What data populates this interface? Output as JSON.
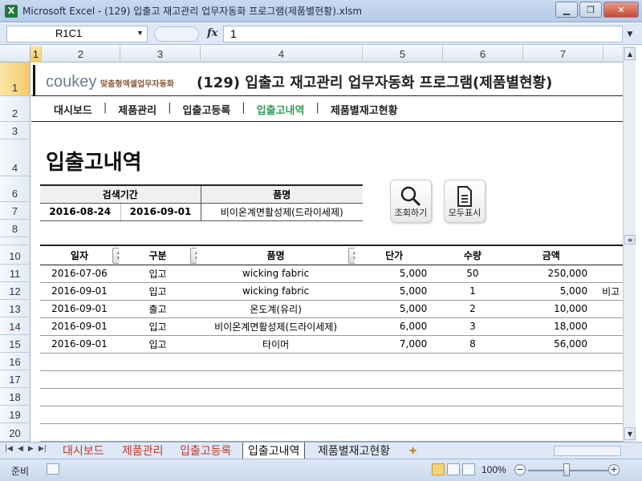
{
  "window": {
    "title": "Microsoft Excel - (129) 입출고 재고관리 업무자동화 프로그램(제품별현황).xlsm"
  },
  "formula_bar": {
    "name_box": "R1C1",
    "fx": "fx",
    "value": "1"
  },
  "columns": [
    "1",
    "2",
    "3",
    "4",
    "5",
    "6",
    "7"
  ],
  "rows": [
    "1",
    "2",
    "3",
    "4",
    "6",
    "7",
    "8",
    "9",
    "10",
    "11",
    "12",
    "13",
    "14",
    "15",
    "16",
    "17",
    "18",
    "19",
    "20"
  ],
  "brand": {
    "logo_text": "coukey",
    "logo_sub": "맞춤형엑셀업무자동화",
    "doc_title": "(129) 입출고 재고관리 업무자동화 프로그램(제품별현황)"
  },
  "nav": {
    "items": [
      "대시보드",
      "제품관리",
      "입출고등록",
      "입출고내역",
      "제품별재고현황"
    ],
    "active_index": 3,
    "active_color": "#2e9e5a"
  },
  "page_heading": "입출고내역",
  "search": {
    "period_label": "검색기간",
    "product_label": "품명",
    "date_from": "2016-08-24",
    "date_to": "2016-09-01",
    "product_value": "비이온계면활성제(드라이세제)"
  },
  "buttons": {
    "search": "조회하기",
    "show_all": "모두표시"
  },
  "table": {
    "headers": [
      "일자",
      "구분",
      "품명",
      "단가",
      "수량",
      "금액"
    ],
    "rows": [
      [
        "2016-07-06",
        "입고",
        "wicking fabric",
        "5,000",
        "50",
        "250,000",
        ""
      ],
      [
        "2016-09-01",
        "입고",
        "wicking fabric",
        "5,000",
        "1",
        "5,000",
        "비고"
      ],
      [
        "2016-09-01",
        "출고",
        "온도계(유리)",
        "5,000",
        "2",
        "10,000",
        ""
      ],
      [
        "2016-09-01",
        "입고",
        "비이온계면활성제(드라이세제)",
        "6,000",
        "3",
        "18,000",
        ""
      ],
      [
        "2016-09-01",
        "입고",
        "타이머",
        "7,000",
        "8",
        "56,000",
        ""
      ]
    ]
  },
  "sheet_tabs": [
    "대시보드",
    "제품관리",
    "입출고등록",
    "입출고내역",
    "제품별재고현황"
  ],
  "active_sheet_index": 3,
  "status": {
    "ready": "준비",
    "zoom": "100%"
  }
}
